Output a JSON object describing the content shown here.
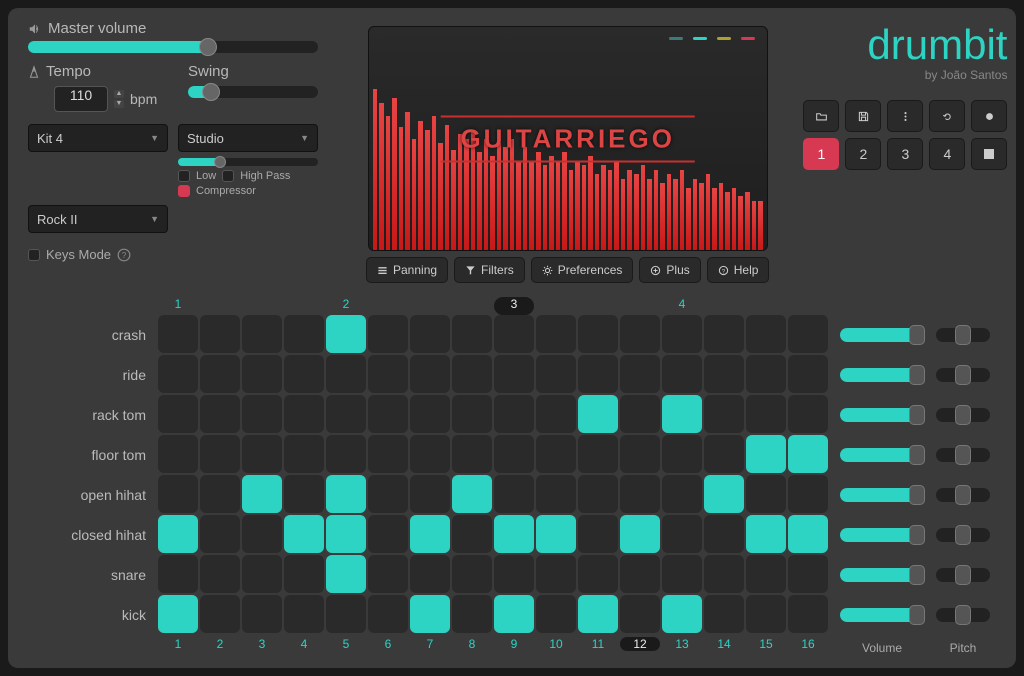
{
  "master_volume": {
    "label": "Master volume",
    "value_pct": 62
  },
  "tempo": {
    "label": "Tempo",
    "value": "110",
    "unit": "bpm"
  },
  "swing": {
    "label": "Swing",
    "value_pct": 18
  },
  "kit_dropdown": "Kit 4",
  "room_dropdown": "Studio",
  "room_slider_pct": 30,
  "filters": {
    "low": "Low",
    "high": "High Pass",
    "comp": "Compressor"
  },
  "genre_dropdown": "Rock II",
  "keys_mode": "Keys Mode",
  "tabs": {
    "panning": "Panning",
    "filters": "Filters",
    "preferences": "Preferences",
    "plus": "Plus",
    "help": "Help"
  },
  "visualizer_watermark": "GUITARRIEGO",
  "viz_dot_colors": [
    "#3b7c7a",
    "#2dd4c4",
    "#b0a030",
    "#d63951"
  ],
  "logo": "drumbit",
  "logo_byline": "by João Santos",
  "pattern_buttons": [
    "1",
    "2",
    "3",
    "4"
  ],
  "active_pattern": 0,
  "beat_markers": [
    "1",
    "2",
    "3",
    "4"
  ],
  "current_beat_marker": 2,
  "current_step": 12,
  "steps": 16,
  "tracks": [
    {
      "name": "crash",
      "cells": [
        0,
        0,
        0,
        0,
        1,
        0,
        0,
        0,
        0,
        0,
        0,
        0,
        0,
        0,
        0,
        0
      ],
      "vol": 92,
      "pitch": 50
    },
    {
      "name": "ride",
      "cells": [
        0,
        0,
        0,
        0,
        0,
        0,
        0,
        0,
        0,
        0,
        0,
        0,
        0,
        0,
        0,
        0
      ],
      "vol": 92,
      "pitch": 50
    },
    {
      "name": "rack tom",
      "cells": [
        0,
        0,
        0,
        0,
        0,
        0,
        0,
        0,
        0,
        0,
        1,
        0,
        1,
        0,
        0,
        0
      ],
      "vol": 92,
      "pitch": 50
    },
    {
      "name": "floor tom",
      "cells": [
        0,
        0,
        0,
        0,
        0,
        0,
        0,
        0,
        0,
        0,
        0,
        0,
        0,
        0,
        1,
        1
      ],
      "vol": 92,
      "pitch": 50
    },
    {
      "name": "open hihat",
      "cells": [
        0,
        0,
        1,
        0,
        1,
        0,
        0,
        1,
        0,
        0,
        0,
        0,
        0,
        1,
        0,
        0
      ],
      "vol": 92,
      "pitch": 50
    },
    {
      "name": "closed hihat",
      "cells": [
        1,
        0,
        0,
        1,
        1,
        0,
        1,
        0,
        1,
        1,
        0,
        1,
        0,
        0,
        1,
        1
      ],
      "vol": 92,
      "pitch": 50
    },
    {
      "name": "snare",
      "cells": [
        0,
        0,
        0,
        0,
        1,
        0,
        0,
        0,
        0,
        0,
        0,
        0,
        0,
        0,
        0,
        0
      ],
      "vol": 92,
      "pitch": 50
    },
    {
      "name": "kick",
      "cells": [
        1,
        0,
        0,
        0,
        0,
        0,
        1,
        0,
        1,
        0,
        1,
        0,
        1,
        0,
        0,
        0
      ],
      "vol": 92,
      "pitch": 50
    }
  ],
  "mixer_labels": {
    "volume": "Volume",
    "pitch": "Pitch"
  }
}
